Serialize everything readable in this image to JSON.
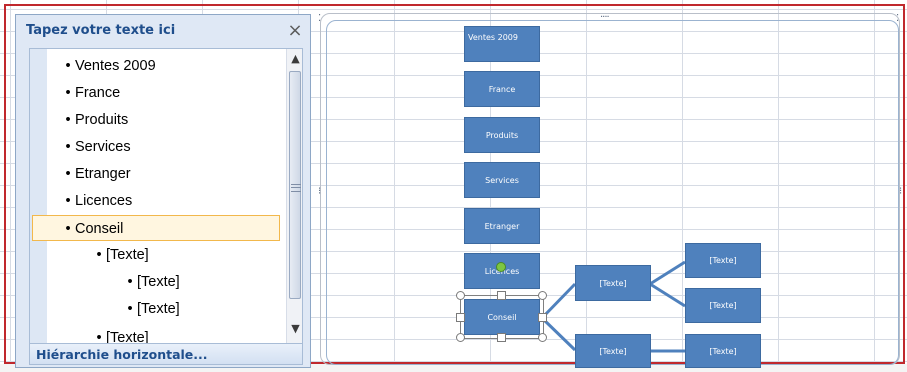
{
  "text_pane": {
    "title": "Tapez votre texte ici",
    "close_symbol": "×",
    "items": [
      {
        "level": 1,
        "bullet": "•",
        "text": "Ventes 2009"
      },
      {
        "level": 1,
        "bullet": "•",
        "text": "France"
      },
      {
        "level": 1,
        "bullet": "•",
        "text": "Produits"
      },
      {
        "level": 1,
        "bullet": "•",
        "text": "Services"
      },
      {
        "level": 1,
        "bullet": "•",
        "text": "Etranger"
      },
      {
        "level": 1,
        "bullet": "•",
        "text": "Licences"
      },
      {
        "level": 1,
        "bullet": "•",
        "text": "Conseil",
        "selected": true
      },
      {
        "level": 2,
        "bullet": "•",
        "text": "[Texte]"
      },
      {
        "level": 3,
        "bullet": "•",
        "text": "[Texte]"
      },
      {
        "level": 3,
        "bullet": "•",
        "text": "[Texte]"
      },
      {
        "level": 2,
        "bullet": "•",
        "text": "[Texte]"
      }
    ],
    "scroll_up": "▲",
    "scroll_down": "▼",
    "footer_link": "Hiérarchie horizontale..."
  },
  "diagram": {
    "nodes": [
      {
        "id": "ventes",
        "text": "Ventes 2009"
      },
      {
        "id": "france",
        "text": "France"
      },
      {
        "id": "produits",
        "text": "Produits"
      },
      {
        "id": "services",
        "text": "Services"
      },
      {
        "id": "etranger",
        "text": "Etranger"
      },
      {
        "id": "licences",
        "text": "Licences"
      },
      {
        "id": "conseil",
        "text": "Conseil"
      },
      {
        "id": "texte-mid",
        "text": "[Texte]"
      },
      {
        "id": "texte-top-right",
        "text": "[Texte]"
      },
      {
        "id": "texte-mid-right",
        "text": "[Texte]"
      },
      {
        "id": "texte-bottom",
        "text": "[Texte]"
      },
      {
        "id": "texte-bottom-right",
        "text": "[Texte]"
      }
    ],
    "frame_handle": "····"
  },
  "colors": {
    "node_fill": "#4f81bd",
    "connector": "#4f81bd",
    "pane_title": "#1f4e8c",
    "sheet_border": "#c0282d",
    "selection_highlight": "#f2b84c"
  }
}
